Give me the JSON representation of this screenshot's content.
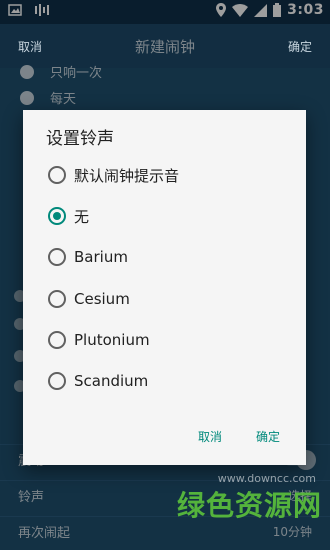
{
  "statusbar": {
    "time": "3:03",
    "icons": [
      "photo-icon",
      "voicemail-icon",
      "location-icon",
      "wifi-icon",
      "signal-icon",
      "battery-icon"
    ]
  },
  "appbar": {
    "cancel_label": "取消",
    "title": "新建闹钟",
    "confirm_label": "确定"
  },
  "background": {
    "repeat_options": [
      {
        "label": "只响一次"
      },
      {
        "label": "每天"
      }
    ],
    "settings": [
      {
        "label": "震动",
        "value": ""
      },
      {
        "label": "铃声",
        "value": "选择"
      },
      {
        "label": "再次闹起",
        "value": "10分钟"
      }
    ]
  },
  "dialog": {
    "title": "设置铃声",
    "options": [
      {
        "label": "默认闹钟提示音",
        "checked": false
      },
      {
        "label": "无",
        "checked": true
      },
      {
        "label": "Barium",
        "checked": false
      },
      {
        "label": "Cesium",
        "checked": false
      },
      {
        "label": "Plutonium",
        "checked": false
      },
      {
        "label": "Scandium",
        "checked": false
      }
    ],
    "cancel_label": "取消",
    "confirm_label": "确定"
  },
  "watermark": {
    "text": "绿色资源网",
    "url": "www.downcc.com"
  },
  "colors": {
    "accent": "#00897b",
    "appbar": "#1d4a69",
    "dialog_bg": "#f5f5f5"
  }
}
